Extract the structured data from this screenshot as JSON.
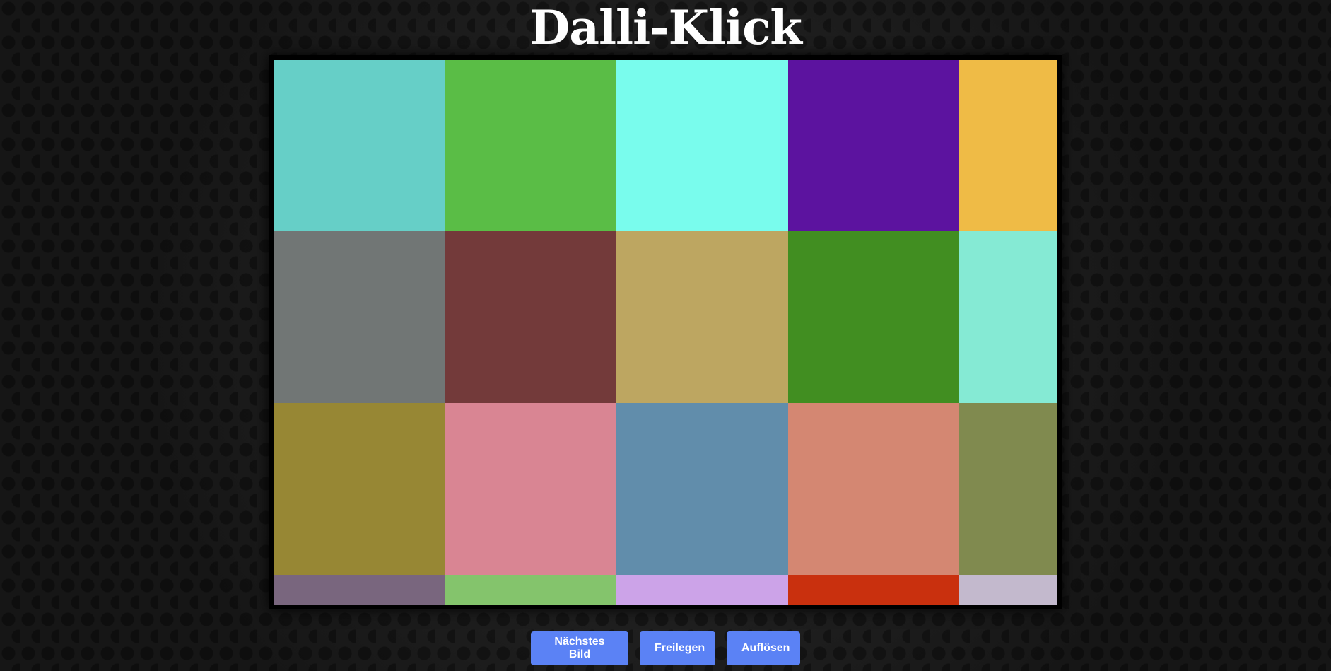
{
  "title": "Dalli-Klick",
  "buttons": {
    "next": "Nächstes Bild",
    "reveal": "Freilegen",
    "solve": "Auflösen"
  },
  "tiles": [
    [
      "#66cfc7",
      "#5abd46",
      "#79fced",
      "#5c139f",
      "#efbb46"
    ],
    [
      "#717675",
      "#733a3a",
      "#bda661",
      "#418e21",
      "#85ead4"
    ],
    [
      "#978734",
      "#d98593",
      "#618dab",
      "#d48772",
      "#808a4f"
    ],
    [
      "#79667e",
      "#84c46c",
      "#cca3e8",
      "#c9300e",
      "#c3b9cd"
    ]
  ]
}
